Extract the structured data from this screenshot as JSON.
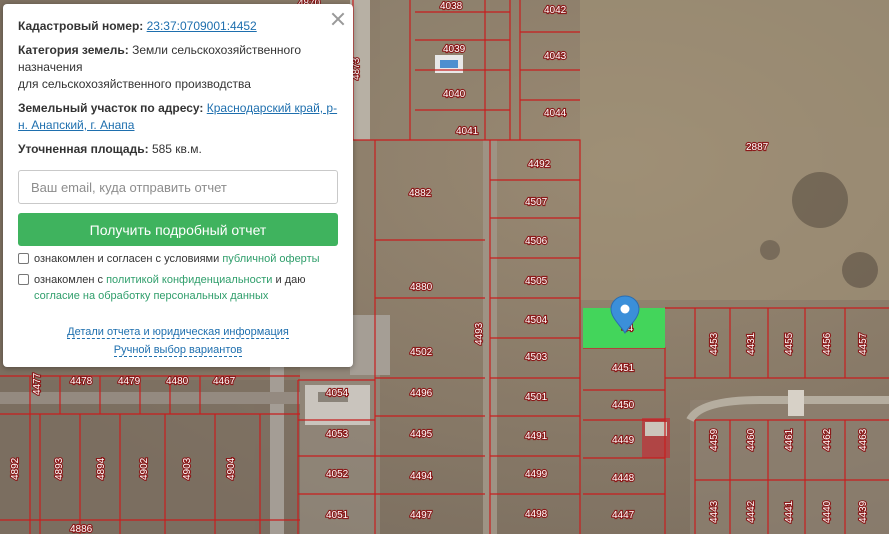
{
  "popup": {
    "cadastral_label": "Кадастровый номер:",
    "cadastral_value": "23:37:0709001:4452",
    "category_label": "Категория земель:",
    "category_value_1": "Земли сельскохозяйственного",
    "category_value_2": "назначения",
    "category_value_3": "для сельскохозяйственного производства",
    "address_label": "Земельный участок по адресу:",
    "address_value_1": "Краснодарский край, р-",
    "address_value_2": "н. Анапский, г. Анапа",
    "area_label": "Уточненная площадь:",
    "area_value": "585 кв.м.",
    "email_placeholder": "Ваш email, куда отправить отчет",
    "button_label": "Получить подробный отчет",
    "check1_text": "ознакомлен и согласен с условиями",
    "check1_link": "публичной оферты",
    "check2_text": "ознакомлен с",
    "check2_link1": "политикой конфиденциальности",
    "check2_mid": "и даю",
    "check2_link2": "согласие на обработку персональных данных",
    "link_details": "Детали отчета и юридическая информация",
    "link_manual": "Ручной выбор вариантов"
  },
  "map": {
    "selected_parcel_color": "#3ddc5a",
    "boundary_color": "#c81e1e",
    "marker_color": "#3b8fd9",
    "labels": [
      {
        "id": "4038",
        "text": "4038"
      },
      {
        "id": "4042",
        "text": "4042"
      },
      {
        "id": "4039",
        "text": "4039"
      },
      {
        "id": "4043",
        "text": "4043"
      },
      {
        "id": "4040",
        "text": "4040"
      },
      {
        "id": "4044",
        "text": "4044"
      },
      {
        "id": "4041",
        "text": "4041"
      },
      {
        "id": "2887",
        "text": "2887"
      },
      {
        "id": "4492",
        "text": "4492"
      },
      {
        "id": "4882",
        "text": "4882"
      },
      {
        "id": "4507",
        "text": "4507"
      },
      {
        "id": "4506",
        "text": "4506"
      },
      {
        "id": "4505",
        "text": "4505"
      },
      {
        "id": "4880",
        "text": "4880"
      },
      {
        "id": "4504",
        "text": "4504"
      },
      {
        "id": "4503",
        "text": "4503"
      },
      {
        "id": "4502",
        "text": "4502"
      },
      {
        "id": "4451",
        "text": "4451"
      },
      {
        "id": "4478",
        "text": "4478"
      },
      {
        "id": "4479",
        "text": "4479"
      },
      {
        "id": "4480",
        "text": "4480"
      },
      {
        "id": "4467",
        "text": "4467"
      },
      {
        "id": "4054",
        "text": "4054"
      },
      {
        "id": "4496",
        "text": "4496"
      },
      {
        "id": "4501",
        "text": "4501"
      },
      {
        "id": "4450",
        "text": "4450"
      },
      {
        "id": "4053",
        "text": "4053"
      },
      {
        "id": "4495",
        "text": "4495"
      },
      {
        "id": "4491",
        "text": "4491"
      },
      {
        "id": "4449",
        "text": "4449"
      },
      {
        "id": "4052",
        "text": "4052"
      },
      {
        "id": "4494",
        "text": "4494"
      },
      {
        "id": "4499",
        "text": "4499"
      },
      {
        "id": "4448",
        "text": "4448"
      },
      {
        "id": "4051",
        "text": "4051"
      },
      {
        "id": "4497",
        "text": "4497"
      },
      {
        "id": "4498",
        "text": "4498"
      },
      {
        "id": "4447",
        "text": "4447"
      },
      {
        "id": "4886",
        "text": "4886"
      },
      {
        "id": "4493",
        "text": "4493"
      },
      {
        "id": "4453",
        "text": "4453"
      },
      {
        "id": "4431",
        "text": "4431"
      },
      {
        "id": "4455",
        "text": "4455"
      },
      {
        "id": "4456",
        "text": "4456"
      },
      {
        "id": "4457",
        "text": "4457"
      },
      {
        "id": "4459",
        "text": "4459"
      },
      {
        "id": "4460",
        "text": "4460"
      },
      {
        "id": "4461",
        "text": "4461"
      },
      {
        "id": "4462",
        "text": "4462"
      },
      {
        "id": "4463",
        "text": "4463"
      },
      {
        "id": "4443",
        "text": "4443"
      },
      {
        "id": "4442",
        "text": "4442"
      },
      {
        "id": "4441",
        "text": "4441"
      },
      {
        "id": "4440",
        "text": "4440"
      },
      {
        "id": "4439",
        "text": "4439"
      },
      {
        "id": "4892",
        "text": "4892"
      },
      {
        "id": "4893",
        "text": "4893"
      },
      {
        "id": "4894",
        "text": "4894"
      },
      {
        "id": "4902",
        "text": "4902"
      },
      {
        "id": "4903",
        "text": "4903"
      },
      {
        "id": "4904",
        "text": "4904"
      },
      {
        "id": "4477",
        "text": "4477"
      },
      {
        "id": "4873",
        "text": "4873"
      },
      {
        "id": "4870",
        "text": "4870"
      },
      {
        "id": "4452",
        "text": "44"
      }
    ]
  }
}
